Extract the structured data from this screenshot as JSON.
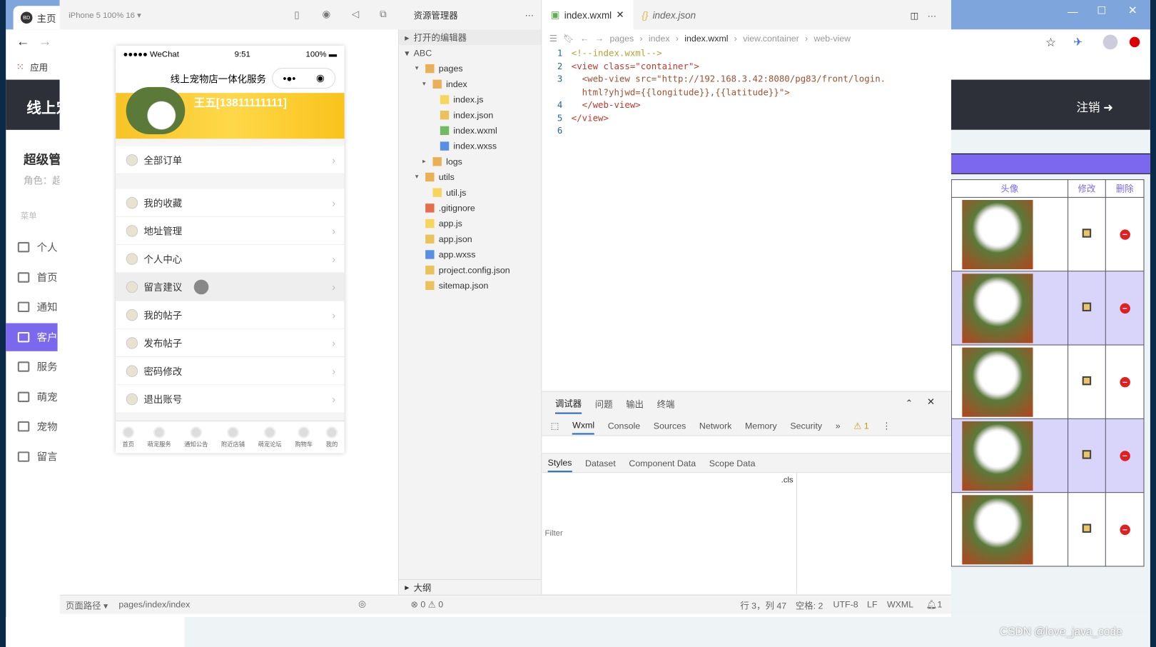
{
  "browser": {
    "tab_label": "主页",
    "tab_badge": "BD",
    "bookmarks_label": "应用",
    "site_title": "线上宠",
    "logout": "注销",
    "user_title": "超级管",
    "role_label": "角色：超",
    "menu_heading": "菜单",
    "sidebar": [
      "个人",
      "首页",
      "通知",
      "客户",
      "服务",
      "萌宠",
      "宠物",
      "留言"
    ],
    "active_sidebar": 3,
    "table_headers": [
      "头像",
      "修改",
      "删除"
    ],
    "table_rows": 5,
    "accent": "#7b68ee"
  },
  "simulator": {
    "device": "iPhone 5 100% 16 ▾",
    "carrier": "●●●●● WeChat",
    "time": "9:51",
    "battery": "100%",
    "nav_title": "线上宠物店一体化服务",
    "capsule_more": "•●•",
    "user": "王五[13811111111]",
    "menu": [
      "全部订单",
      "我的收藏",
      "地址管理",
      "个人中心",
      "留言建议",
      "我的帖子",
      "发布帖子",
      "密码修改",
      "退出账号"
    ],
    "tabbar": [
      "首页",
      "萌宠服务",
      "通知公告",
      "附近店铺",
      "萌宠论坛",
      "购物车",
      "我的"
    ]
  },
  "explorer": {
    "title": "资源管理器",
    "open_editors": "打开的编辑器",
    "project": "ABC",
    "outline": "大纲",
    "tree": [
      {
        "label": "pages",
        "depth": 1,
        "type": "folder"
      },
      {
        "label": "index",
        "depth": 2,
        "type": "folder"
      },
      {
        "label": "index.js",
        "depth": 3,
        "type": "js"
      },
      {
        "label": "index.json",
        "depth": 3,
        "type": "json"
      },
      {
        "label": "index.wxml",
        "depth": 3,
        "type": "wxml"
      },
      {
        "label": "index.wxss",
        "depth": 3,
        "type": "wxss"
      },
      {
        "label": "logs",
        "depth": 2,
        "type": "folder"
      },
      {
        "label": "utils",
        "depth": 1,
        "type": "folder"
      },
      {
        "label": "util.js",
        "depth": 2,
        "type": "js"
      },
      {
        "label": ".gitignore",
        "depth": 1,
        "type": "git"
      },
      {
        "label": "app.js",
        "depth": 1,
        "type": "js"
      },
      {
        "label": "app.json",
        "depth": 1,
        "type": "json"
      },
      {
        "label": "app.wxss",
        "depth": 1,
        "type": "wxss"
      },
      {
        "label": "project.config.json",
        "depth": 1,
        "type": "json"
      },
      {
        "label": "sitemap.json",
        "depth": 1,
        "type": "json"
      }
    ]
  },
  "editor": {
    "tabs": [
      "index.wxml",
      "index.json"
    ],
    "breadcrumb": [
      "pages",
      "index",
      "index.wxml",
      "view.container",
      "web-view"
    ],
    "lines": [
      {
        "n": "1",
        "t": "<!--index.wxml-->"
      },
      {
        "n": "2",
        "t": "<view class=\"container\">"
      },
      {
        "n": "3",
        "t": "  <web-view src=\"http://192.168.3.42:8080/pg83/front/login."
      },
      {
        "n": "",
        "t": "  html?yhjwd={{longitude}},{{latitude}}\">"
      },
      {
        "n": "4",
        "t": "  </web-view>"
      },
      {
        "n": "5",
        "t": "</view>"
      },
      {
        "n": "6",
        "t": ""
      }
    ]
  },
  "debugger": {
    "top_tabs": [
      "调试器",
      "问题",
      "输出",
      "终端"
    ],
    "tools": [
      "Wxml",
      "Console",
      "Sources",
      "Network",
      "Memory",
      "Security"
    ],
    "more": "»",
    "warnings": "⚠ 1",
    "sub_tabs": [
      "Styles",
      "Dataset",
      "Component Data",
      "Scope Data"
    ],
    "filter_placeholder": "Filter",
    "cls": ".cls"
  },
  "statusbar": {
    "page_path": "页面路径 ▾",
    "path": "pages/index/index",
    "errors": "⊗ 0 ⚠ 0",
    "position": "行 3，列 47",
    "spaces": "空格: 2",
    "encoding": "UTF-8",
    "eol": "LF",
    "lang": "WXML",
    "notif": "1"
  },
  "watermark": "CSDN @love_java_code"
}
